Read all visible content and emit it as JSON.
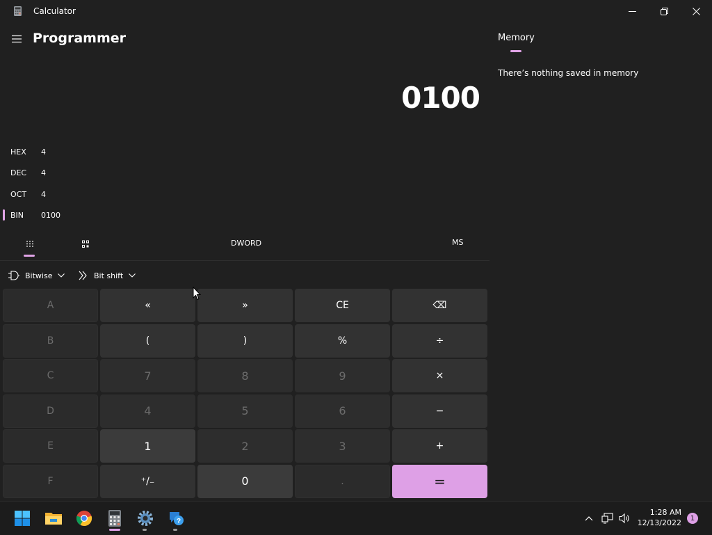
{
  "window": {
    "title": "Calculator",
    "icon": "calculator-icon",
    "controls": [
      "minimize-icon",
      "restore-icon",
      "close-icon"
    ]
  },
  "header": {
    "mode": "Programmer",
    "menu_icon": "hamburger-menu-icon"
  },
  "display": {
    "value": "0100"
  },
  "radix": [
    {
      "label": "HEX",
      "value": "4",
      "selected": false
    },
    {
      "label": "DEC",
      "value": "4",
      "selected": false
    },
    {
      "label": "OCT",
      "value": "4",
      "selected": false
    },
    {
      "label": "BIN",
      "value": "0100",
      "selected": true
    }
  ],
  "toolbar": {
    "tabs": [
      "full-keypad-icon",
      "bit-toggle-keypad-icon"
    ],
    "word_size": "DWORD",
    "memory_store": "MS"
  },
  "dropdowns": {
    "bitwise": "Bitwise",
    "bitshift": "Bit shift"
  },
  "keys": [
    [
      "A",
      "«",
      "»",
      "CE",
      "⌫"
    ],
    [
      "B",
      "(",
      ")",
      "%",
      "÷"
    ],
    [
      "C",
      "7",
      "8",
      "9",
      "×"
    ],
    [
      "D",
      "4",
      "5",
      "6",
      "−"
    ],
    [
      "E",
      "1",
      "2",
      "3",
      "+"
    ],
    [
      "F",
      "⁺/₋",
      "0",
      ".",
      "="
    ]
  ],
  "memory": {
    "tab": "Memory",
    "empty_message": "There’s nothing saved in memory"
  },
  "taskbar": {
    "apps": [
      "windows-start-icon",
      "file-explorer-icon",
      "chrome-icon",
      "calculator-icon",
      "settings-icon",
      "get-help-icon"
    ],
    "time": "1:28 AM",
    "date": "12/13/2022",
    "notification_count": "1"
  },
  "colors": {
    "background": "#202020",
    "accent": "#dea0e6",
    "taskbar": "#1c1c1c"
  }
}
